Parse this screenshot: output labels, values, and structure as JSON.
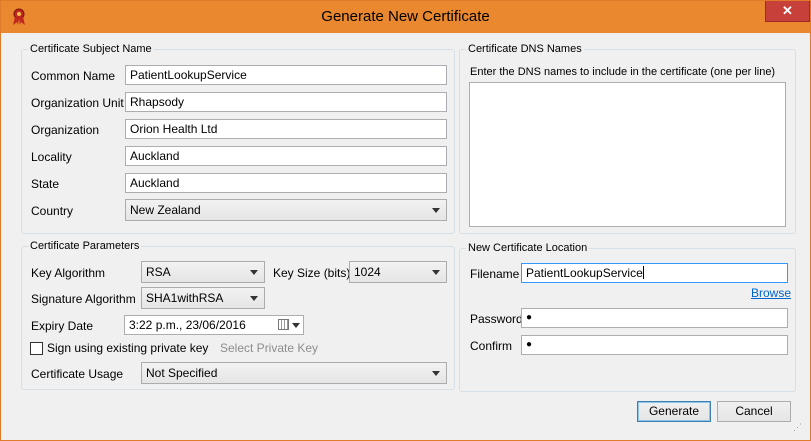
{
  "window": {
    "title": "Generate New Certificate",
    "close_glyph": "✕"
  },
  "subject": {
    "legend": "Certificate Subject Name",
    "common_name": {
      "label": "Common Name",
      "value": "PatientLookupService"
    },
    "org_unit": {
      "label": "Organization Unit",
      "value": "Rhapsody"
    },
    "organization": {
      "label": "Organization",
      "value": "Orion Health Ltd"
    },
    "locality": {
      "label": "Locality",
      "value": "Auckland"
    },
    "state": {
      "label": "State",
      "value": "Auckland"
    },
    "country": {
      "label": "Country",
      "value": "New Zealand"
    }
  },
  "dns": {
    "legend": "Certificate DNS Names",
    "hint": "Enter the DNS names to include in the certificate (one per line)"
  },
  "params": {
    "legend": "Certificate Parameters",
    "key_algorithm": {
      "label": "Key Algorithm",
      "value": "RSA"
    },
    "key_size": {
      "label": "Key Size (bits)",
      "value": "1024"
    },
    "signature_algorithm": {
      "label": "Signature Algorithm",
      "value": "SHA1withRSA"
    },
    "expiry": {
      "label": "Expiry Date",
      "value": "3:22 p.m., 23/06/2016"
    },
    "use_existing_key": {
      "label": "Sign using existing private key",
      "checked": false
    },
    "select_key_label": "Select Private Key",
    "usage": {
      "label": "Certificate Usage",
      "value": "Not Specified"
    }
  },
  "location": {
    "legend": "New Certificate Location",
    "filename": {
      "label": "Filename",
      "value": "PatientLookupService"
    },
    "browse_label": "Browse",
    "password": {
      "label": "Password",
      "value": "●"
    },
    "confirm": {
      "label": "Confirm",
      "value": "●"
    }
  },
  "actions": {
    "generate_label": "Generate",
    "cancel_label": "Cancel"
  },
  "colors": {
    "titlebar": "#e9882f",
    "close": "#c7413a",
    "link": "#0066cc"
  }
}
